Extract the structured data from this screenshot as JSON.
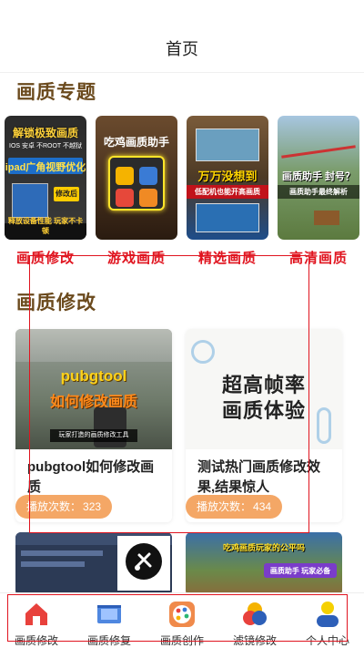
{
  "header": {
    "title": "首页"
  },
  "sections": {
    "topics_title": "画质专题",
    "modify_title": "画质修改"
  },
  "categories": [
    {
      "label": "画质修改",
      "thumb_lines": [
        "解锁极致画质",
        "IOS 安卓 不ROOT 不越狱",
        "ipad广角视野优化",
        "修改后",
        "释放设备性能 玩家不卡顿"
      ]
    },
    {
      "label": "游戏画质",
      "thumb_lines": [
        "吃鸡画质助手"
      ]
    },
    {
      "label": "精选画质",
      "thumb_lines": [
        "万万没想到",
        "低配机也能开高画质"
      ]
    },
    {
      "label": "高清画质",
      "thumb_lines": [
        "画质助手 封号？",
        "画质助手最终解析"
      ]
    }
  ],
  "cards": [
    {
      "thumb_lines": [
        "pubgtool",
        "如何修改画质",
        "玩家打造的画质修改工具"
      ],
      "title": "pubgtool如何修改画质",
      "plays_label": "播放次数：",
      "plays": "323"
    },
    {
      "thumb_lines": [
        "超高帧率",
        "画质体验"
      ],
      "title": "测试热门画质修改效果,结果惊人",
      "plays_label": "播放次数：",
      "plays": "434"
    }
  ],
  "row2": [
    {
      "thumb_lines": []
    },
    {
      "thumb_lines": [
        "吃鸡画质玩家的公平吗",
        "画质助手 玩家必备"
      ]
    }
  ],
  "tabs": [
    {
      "label": "画质修改",
      "icon": "home-icon",
      "active": true
    },
    {
      "label": "画质修复",
      "icon": "film-icon"
    },
    {
      "label": "画质创作",
      "icon": "palette-icon"
    },
    {
      "label": "滤镜修改",
      "icon": "filter-circles-icon"
    },
    {
      "label": "个人中心",
      "icon": "user-icon"
    }
  ],
  "colors": {
    "accent_red": "#e0141f",
    "section_title": "#6b4a1d",
    "badge": "#f4a766"
  }
}
